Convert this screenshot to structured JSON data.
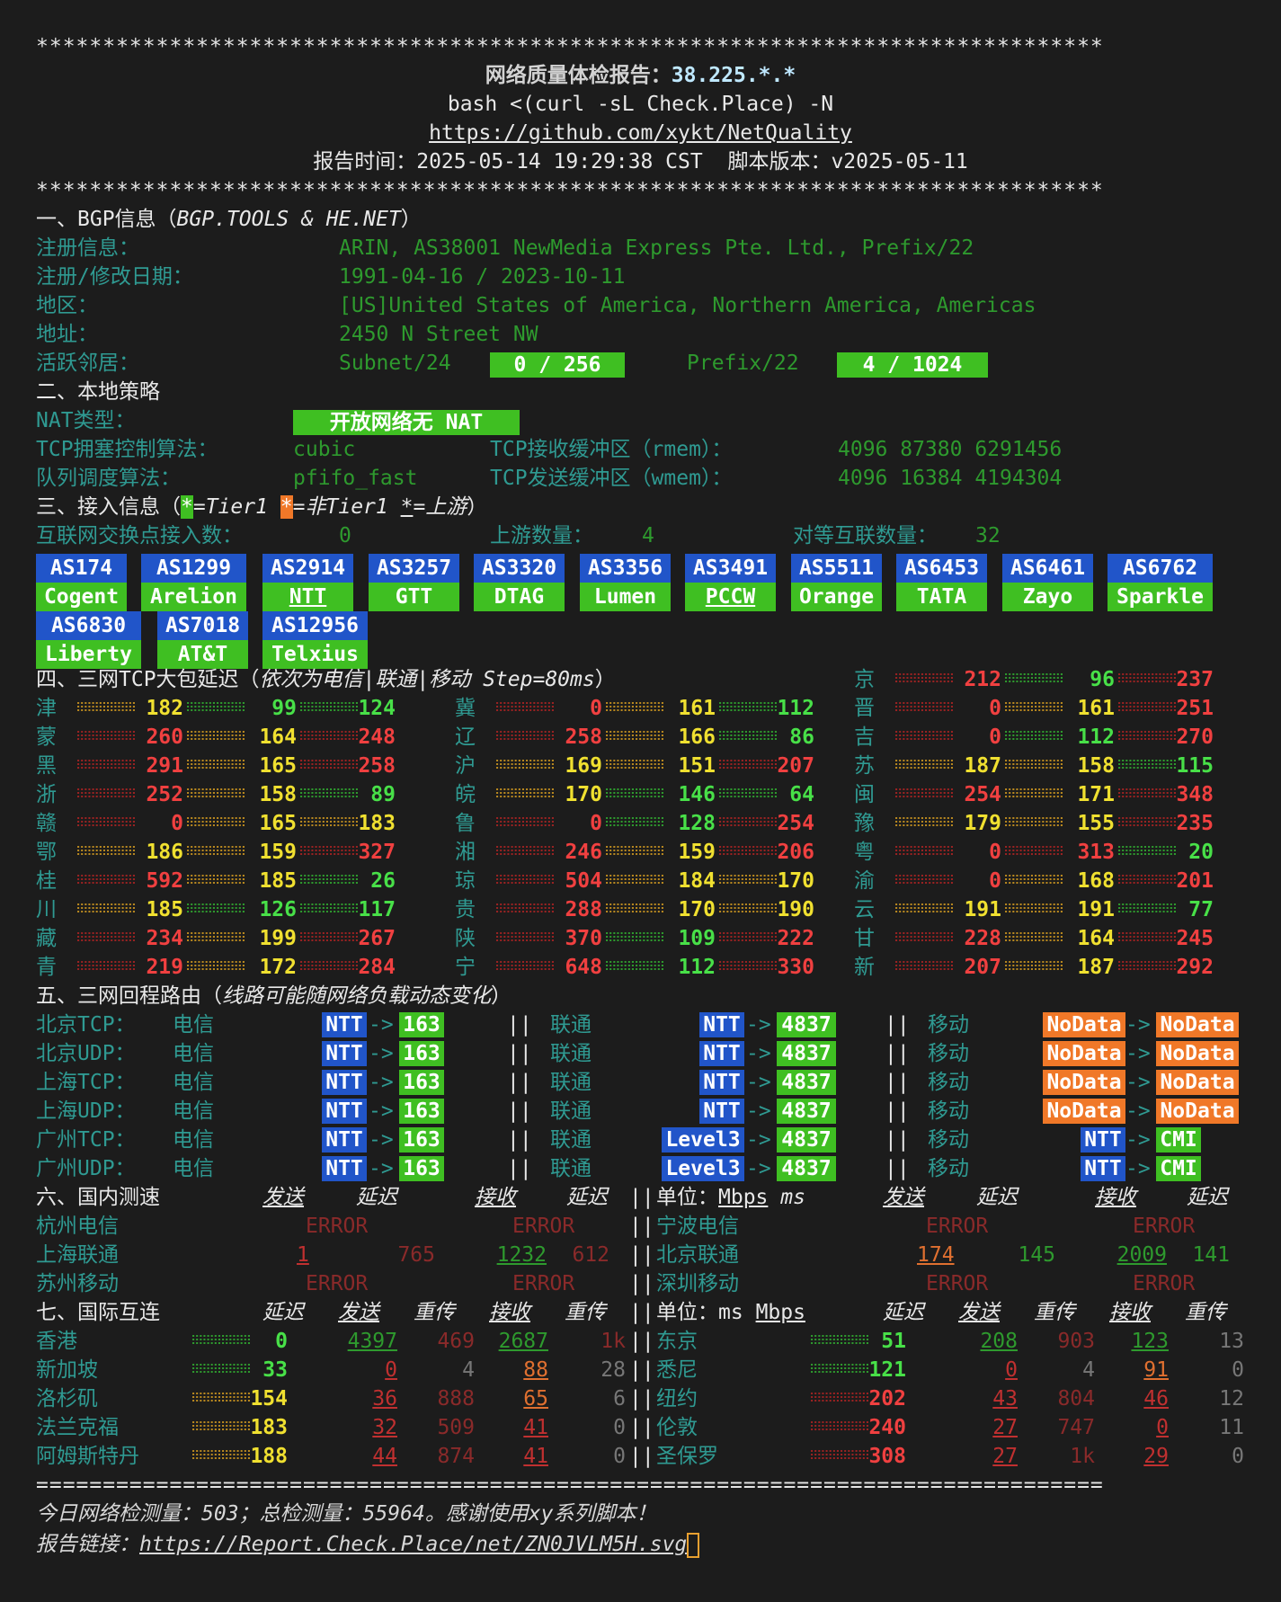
{
  "stars": "********************************************************************************",
  "header": {
    "title": "网络质量体检报告：",
    "ip": "38.225.*.*",
    "command": "bash <(curl -sL Check.Place) -N",
    "link": "https://github.com/xykt/NetQuality",
    "time_label": "报告时间：",
    "time": "2025-05-14 19:29:38 CST",
    "version_label": "脚本版本：",
    "version": "v2025-05-11"
  },
  "bgp": {
    "title": "一、BGP信息（",
    "source": "BGP.TOOLS & HE.NET",
    "title_end": "）",
    "reg_label": "注册信息：",
    "reg": "ARIN, AS38001 NewMedia Express Pte. Ltd., Prefix/22",
    "date_label": "注册/修改日期：",
    "date": "1991-04-16 / 2023-10-11",
    "region_label": "地区：",
    "region": "[US]United States of America, Northern America, Americas",
    "addr_label": "地址：",
    "addr": "2450 N Street NW",
    "neigh_label": "活跃邻居：",
    "subnet_label": "Subnet/24",
    "subnet_val": "0 / 256",
    "prefix_label": "Prefix/22",
    "prefix_val": "4 / 1024"
  },
  "policy": {
    "title": "二、本地策略",
    "nat_label": "NAT类型：",
    "nat": "开放网络无 NAT",
    "tcp_label": "TCP拥塞控制算法：",
    "tcp": "cubic",
    "rmem_label": "TCP接收缓冲区（rmem）：",
    "rmem": "4096 87380 6291456",
    "qdisc_label": "队列调度算法：",
    "qdisc": "pfifo_fast",
    "wmem_label": "TCP发送缓冲区（wmem）：",
    "wmem": "4096 16384 4194304"
  },
  "access": {
    "title": "三、接入信息（",
    "star": "*",
    "t1": "=Tier1 ",
    "nt1": "=非Tier1 ",
    "up": "=上游",
    "end": "）",
    "ix_label": "互联网交换点接入数：",
    "ix": "0",
    "upstream_label": "上游数量：",
    "upstream": "4",
    "peer_label": "对等互联数量：",
    "peer": "32",
    "asns": [
      {
        "as": "AS174",
        "name": "Cogent"
      },
      {
        "as": "AS1299",
        "name": "Arelion"
      },
      {
        "as": "AS2914",
        "name": "NTT"
      },
      {
        "as": "AS3257",
        "name": "GTT"
      },
      {
        "as": "AS3320",
        "name": "DTAG"
      },
      {
        "as": "AS3356",
        "name": "Lumen"
      },
      {
        "as": "AS3491",
        "name": "PCCW"
      },
      {
        "as": "AS5511",
        "name": "Orange"
      },
      {
        "as": "AS6453",
        "name": "TATA"
      },
      {
        "as": "AS6461",
        "name": "Zayo"
      },
      {
        "as": "AS6762",
        "name": "Sparkle"
      },
      {
        "as": "AS6830",
        "name": "Liberty"
      },
      {
        "as": "AS7018",
        "name": "AT&T"
      },
      {
        "as": "AS12956",
        "name": "Telxius"
      }
    ]
  },
  "latency": {
    "title": "四、三网TCP大包延迟（",
    "note": "依次为电信|联通|移动 Step=80ms",
    "end": "）",
    "cells": [
      [
        "京",
        "212",
        "96",
        "237"
      ],
      [
        "津",
        "182",
        "99",
        "124"
      ],
      [
        "冀",
        "0",
        "161",
        "112"
      ],
      [
        "晋",
        "0",
        "161",
        "251"
      ],
      [
        "蒙",
        "260",
        "164",
        "248"
      ],
      [
        "辽",
        "258",
        "166",
        "86"
      ],
      [
        "吉",
        "0",
        "112",
        "270"
      ],
      [
        "黑",
        "291",
        "165",
        "258"
      ],
      [
        "沪",
        "169",
        "151",
        "207"
      ],
      [
        "苏",
        "187",
        "158",
        "115"
      ],
      [
        "浙",
        "252",
        "158",
        "89"
      ],
      [
        "皖",
        "170",
        "146",
        "64"
      ],
      [
        "闽",
        "254",
        "171",
        "348"
      ],
      [
        "赣",
        "0",
        "165",
        "183"
      ],
      [
        "鲁",
        "0",
        "128",
        "254"
      ],
      [
        "豫",
        "179",
        "155",
        "235"
      ],
      [
        "鄂",
        "186",
        "159",
        "327"
      ],
      [
        "湘",
        "246",
        "159",
        "206"
      ],
      [
        "粤",
        "0",
        "313",
        "20"
      ],
      [
        "桂",
        "592",
        "185",
        "26"
      ],
      [
        "琼",
        "504",
        "184",
        "170"
      ],
      [
        "渝",
        "0",
        "168",
        "201"
      ],
      [
        "川",
        "185",
        "126",
        "117"
      ],
      [
        "贵",
        "288",
        "170",
        "190"
      ],
      [
        "云",
        "191",
        "191",
        "77"
      ],
      [
        "藏",
        "234",
        "199",
        "267"
      ],
      [
        "陕",
        "370",
        "109",
        "222"
      ],
      [
        "甘",
        "228",
        "164",
        "245"
      ],
      [
        "青",
        "219",
        "172",
        "284"
      ],
      [
        "宁",
        "648",
        "112",
        "330"
      ],
      [
        "新",
        "207",
        "187",
        "292"
      ]
    ]
  },
  "route": {
    "title": "五、三网回程路由（",
    "note": "线路可能随网络负载动态变化",
    "end": "）",
    "ct": "电信",
    "cu": "联通",
    "cm": "移动",
    "sep": "||",
    "arrow": "->",
    "rows": [
      {
        "label": "北京TCP：",
        "ct": [
          "NTT",
          "163"
        ],
        "cu": [
          "NTT",
          "4837"
        ],
        "cm": [
          "NoData",
          "NoData"
        ]
      },
      {
        "label": "北京UDP：",
        "ct": [
          "NTT",
          "163"
        ],
        "cu": [
          "NTT",
          "4837"
        ],
        "cm": [
          "NoData",
          "NoData"
        ]
      },
      {
        "label": "上海TCP：",
        "ct": [
          "NTT",
          "163"
        ],
        "cu": [
          "NTT",
          "4837"
        ],
        "cm": [
          "NoData",
          "NoData"
        ]
      },
      {
        "label": "上海UDP：",
        "ct": [
          "NTT",
          "163"
        ],
        "cu": [
          "NTT",
          "4837"
        ],
        "cm": [
          "NoData",
          "NoData"
        ]
      },
      {
        "label": "广州TCP：",
        "ct": [
          "NTT",
          "163"
        ],
        "cu": [
          "Level3",
          "4837"
        ],
        "cm": [
          "NTT",
          "CMI"
        ]
      },
      {
        "label": "广州UDP：",
        "ct": [
          "NTT",
          "163"
        ],
        "cu": [
          "Level3",
          "4837"
        ],
        "cm": [
          "NTT",
          "CMI"
        ]
      }
    ]
  },
  "speed": {
    "title": "六、国内测速",
    "send": "发送",
    "delay": "延迟",
    "recv": "接收",
    "unit_label": "单位：",
    "unit1": "Mbps",
    "unit2": "ms",
    "error": "ERROR",
    "sep": "||",
    "left": [
      {
        "name": "杭州电信",
        "err": true
      },
      {
        "name": "上海联通",
        "send": "1",
        "sd": "765",
        "recv": "1232",
        "rd": "612"
      },
      {
        "name": "苏州移动",
        "err": true
      }
    ],
    "right": [
      {
        "name": "宁波电信",
        "err": true
      },
      {
        "name": "北京联通",
        "send": "174",
        "sd": "145",
        "recv": "2009",
        "rd": "141"
      },
      {
        "name": "深圳移动",
        "err": true
      }
    ]
  },
  "intl": {
    "title": "七、国际互连",
    "delay": "延迟",
    "send": "发送",
    "retr": "重传",
    "recv": "接收",
    "unit_label": "单位：",
    "unit1": "ms",
    "unit2": "Mbps",
    "sep": "||",
    "left": [
      {
        "name": "香港",
        "lat": "0",
        "send": "4397",
        "sr": "469",
        "recv": "2687",
        "rr": "1k"
      },
      {
        "name": "新加坡",
        "lat": "33",
        "send": "0",
        "sr": "4",
        "recv": "88",
        "rr": "28"
      },
      {
        "name": "洛杉矶",
        "lat": "154",
        "send": "36",
        "sr": "888",
        "recv": "65",
        "rr": "6"
      },
      {
        "name": "法兰克福",
        "lat": "183",
        "send": "32",
        "sr": "509",
        "recv": "41",
        "rr": "0"
      },
      {
        "name": "阿姆斯特丹",
        "lat": "188",
        "send": "44",
        "sr": "874",
        "recv": "41",
        "rr": "0"
      }
    ],
    "right": [
      {
        "name": "东京",
        "lat": "51",
        "send": "208",
        "sr": "903",
        "recv": "123",
        "rr": "13"
      },
      {
        "name": "悉尼",
        "lat": "121",
        "send": "0",
        "sr": "4",
        "recv": "91",
        "rr": "0"
      },
      {
        "name": "纽约",
        "lat": "202",
        "send": "43",
        "sr": "804",
        "recv": "46",
        "rr": "12"
      },
      {
        "name": "伦敦",
        "lat": "240",
        "send": "27",
        "sr": "747",
        "recv": "0",
        "rr": "11"
      },
      {
        "name": "圣保罗",
        "lat": "308",
        "send": "27",
        "sr": "1k",
        "recv": "29",
        "rr": "0"
      }
    ]
  },
  "footer": {
    "rule": "================================================================================",
    "stats": "今日网络检测量：503；总检测量：55964。感谢使用xy系列脚本！",
    "link_label": "报告链接：",
    "link": "https://Report.Check.Place/net/ZN0JVLM5H.svg"
  },
  "colors": {
    "background": "#1c1c1c",
    "label": "#2f9a92",
    "value": "#2e9a2e",
    "tag_blue": "#2155c9",
    "tag_green": "#3fbf22",
    "tag_orange": "#f07828"
  }
}
